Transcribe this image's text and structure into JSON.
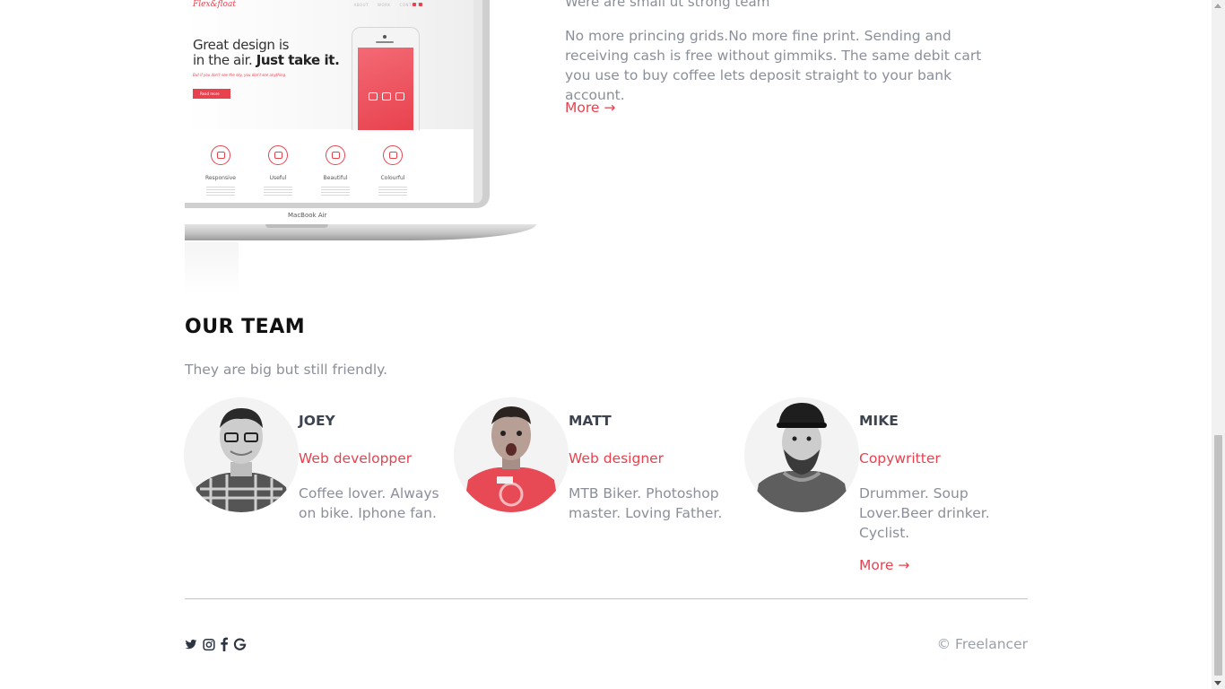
{
  "mockup": {
    "logo": "Flex&float",
    "nav": [
      "ABOUT",
      "WORK",
      "CONTACT"
    ],
    "hero_line1": "Great design is",
    "hero_line2_a": "in the air. ",
    "hero_line2_b": "Just take it.",
    "hero_sub": "But if you don't see the sky, you don't see anything.",
    "hero_button": "Read more",
    "features": [
      "Responsive",
      "Useful",
      "Beautiful",
      "Colourful"
    ],
    "device_label": "MacBook Air"
  },
  "about": {
    "heading": "Were are small ut strong team",
    "text": "No more princing grids.No more fine print. Sending and receiving cash is free without gimmiks. The same debit cart you use to buy coffee lets deposit straight to your bank account.",
    "more_label": "More →"
  },
  "team": {
    "title": "OUR TEAM",
    "subtitle": "They are big but still friendly.",
    "members": [
      {
        "name": "JOEY",
        "role": "Web developper",
        "bio": "Coffee lover. Always on bike. Iphone fan."
      },
      {
        "name": "MATT",
        "role": "Web designer",
        "bio": "MTB Biker. Photoshop master. Loving Father."
      },
      {
        "name": "MIKE",
        "role": "Copywritter",
        "bio": "Drummer. Soup Lover.Beer drinker. Cyclist."
      }
    ],
    "more_label": "More →"
  },
  "footer": {
    "social_icons": [
      "twitter-icon",
      "instagram-icon",
      "facebook-icon",
      "google-icon"
    ],
    "copyright": "© Freelancer"
  },
  "colors": {
    "accent": "#e8424e",
    "text_muted": "#8a8f99",
    "heading": "#111111"
  }
}
